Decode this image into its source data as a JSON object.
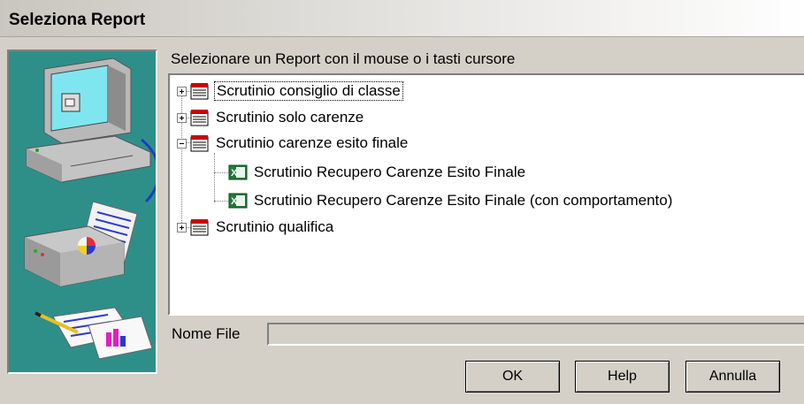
{
  "window": {
    "title": "Seleziona Report"
  },
  "instruction": "Selezionare un Report con il mouse o i tasti cursore",
  "tree": {
    "items": [
      {
        "label": "Scrutinio consiglio di classe",
        "icon": "report-icon",
        "expander": "plus",
        "selected": true
      },
      {
        "label": "Scrutinio solo carenze",
        "icon": "report-icon",
        "expander": "plus"
      },
      {
        "label": "Scrutinio carenze esito finale",
        "icon": "report-icon",
        "expander": "minus",
        "children": [
          {
            "label": "Scrutinio Recupero Carenze Esito Finale",
            "icon": "excel-icon"
          },
          {
            "label": "Scrutinio Recupero Carenze Esito Finale (con comportamento)",
            "icon": "excel-icon"
          }
        ]
      },
      {
        "label": "Scrutinio qualifica",
        "icon": "report-icon",
        "expander": "plus"
      }
    ]
  },
  "file": {
    "label": "Nome File",
    "value": ""
  },
  "buttons": {
    "ok": "OK",
    "help": "Help",
    "cancel": "Annulla"
  },
  "colors": {
    "illustration_bg": "#2e8f89",
    "window_bg": "#d4d0c8",
    "report_icon_red": "#cc0000",
    "excel_green": "#1e7b34"
  }
}
